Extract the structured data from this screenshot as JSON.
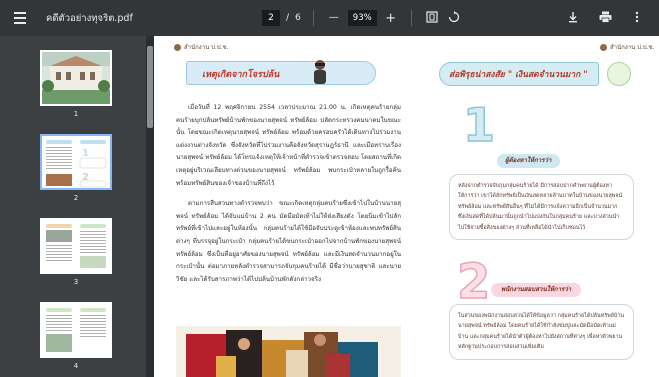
{
  "toolbar": {
    "filename": "คดีตัวอย่างทุจริต.pdf",
    "current_page": "2",
    "page_sep": "/",
    "total_pages": "6",
    "zoom_out": "—",
    "zoom_value": "93%",
    "zoom_in": "+",
    "icons": [
      "menu-icon",
      "fit-page-icon",
      "rotate-icon",
      "download-icon",
      "print-icon",
      "more-icon"
    ]
  },
  "sidebar": {
    "thumbnails": [
      {
        "label": "1"
      },
      {
        "label": "2",
        "selected": true
      },
      {
        "label": "3"
      },
      {
        "label": "4"
      }
    ]
  },
  "page": {
    "header_left": "สำนักงาน ป.ป.ช.",
    "header_right": "สำนักงาน ป.ป.ช.",
    "left_title": "เหตุเกิดจากโจรปล้น",
    "para1": "เมื่อวันที่ 12 พฤศจิกายน 2554 เวลาประมาณ 21.00 น. เกิดเหตุคนร้ายกลุ่มคนร้ายบุกปล้นทรัพย์บ้านพักของนายสุพจน์ ทรัพย์ล้อม ปลัดกระทรวงคมนาคมในขณะนั้น โดยขณะเกิดเหตุนายสุพจน์ ทรัพย์ล้อม พร้อมด้วยครอบครัวได้เดินทางไปร่วมงานแต่งงานต่างจังหวัด ซึ่งจังหวัดที่ไปร่วมงานคือจังหวัดสุราษฎร์ธานี และเมื่อทราบเรื่องนายสุพจน์ ทรัพย์ล้อม ได้โทรแจ้งเหตุให้เจ้าหน้าที่ตำรวจเข้าตรวจสอบ โดยสถานที่เกิดเหตุอยู่บริเวณเลียบทางด่วนของนายสุพจน์ ทรัพย์ล้อม พบกระเป๋าหลายใบถูกรื้อค้น พร้อมทรัพย์สินของเจ้าของบ้านที่ถึงไว้",
    "para2": "ตามการสืบสวนทางตำรวจพบว่า ขณะเกิดเหตุกลุ่มคนร้ายซึ่งเข้าไปในบ้านนายสุพจน์ ทรัพย์ล้อม ได้จับแม่บ้าน 2 คน มัดมือมัดเท้าไม่ให้ส่งเสียงดัง โดยนิ่มเข้าไปลักทรัพย์ที่เข้าไปและอยู่ในห้องนั้น กลุ่มคนร้ายได้ใช้มือจับประตูเข้าห้องและพบทรัพย์สินต่างๆ ที่บรรจุอยู่ในกระเป๋า กลุ่มคนร้ายได้ขนกระเป๋าออกไปจากบ้านพักของนายสุพจน์ ทรัพย์ล้อม ซึ่งเป็นที่อยู่อาศัยของนายสุพจน์ ทรัพย์ล้อม และมีเงินสดจำนวนมากอยู่ในกระเป๋านั้น ต่อมาภายหลังตำรวจสามารถจับกุมคนร้ายได้ มีชื่อว่านายสุชาติ และนายวิชัย และได้รับสารภาพว่าได้ไปปล้นบ้านพักดังกล่าวจริง",
    "right_title": "ส่อพิรุธน่าสงสัย \" เงินสดจำนวนมาก \"",
    "num1": "1",
    "tag1": "ผู้ต้องหาให้การว่า",
    "box1": "หลังจากตำรวจจับกุมกลุ่มคนร้ายได้ มีการสอบปากคำพยานผู้ต้องหาให้การว่า เขาได้ลักทรัพย์เป็นเงินสดหลายล้านบาทในบ้านของนายสุพจน์ ทรัพย์ล้อม และทรัพย์สินอื่นๆ ที่ไม่ได้มีการแจ้งความอีกเป็นจำนวนมาก ซึ่งเงินสดที่ได้ปล้นมานั้นถูกนำไปแบ่งกันในกลุ่มคนร้าย และบางส่วนนำไปใช้จ่ายซื้อสิ่งของต่างๆ ส่วนที่เหลือได้นำไปเก็บซ่อนไว้",
    "num2": "2",
    "tag2": "พนักงานสอบสวนให้การว่า",
    "box2": "ในส่วนของพนักงานสอบสวนได้ให้ข้อมูลว่า กลุ่มคนร้ายได้ปล้นทรัพย์บ้านนายสุพจน์ ทรัพย์ล้อม โดยคนร้ายได้ใช้กำลังข่มขู่และมัดมือมัดเท้าแม่บ้าน และกลุ่มคนร้ายได้นำตัวผู้ต้องหาไปยังสถานที่ต่างๆ เพื่อหาตัวพยานหลักฐานประกอบการสอบสวนเพิ่มเติม"
  }
}
